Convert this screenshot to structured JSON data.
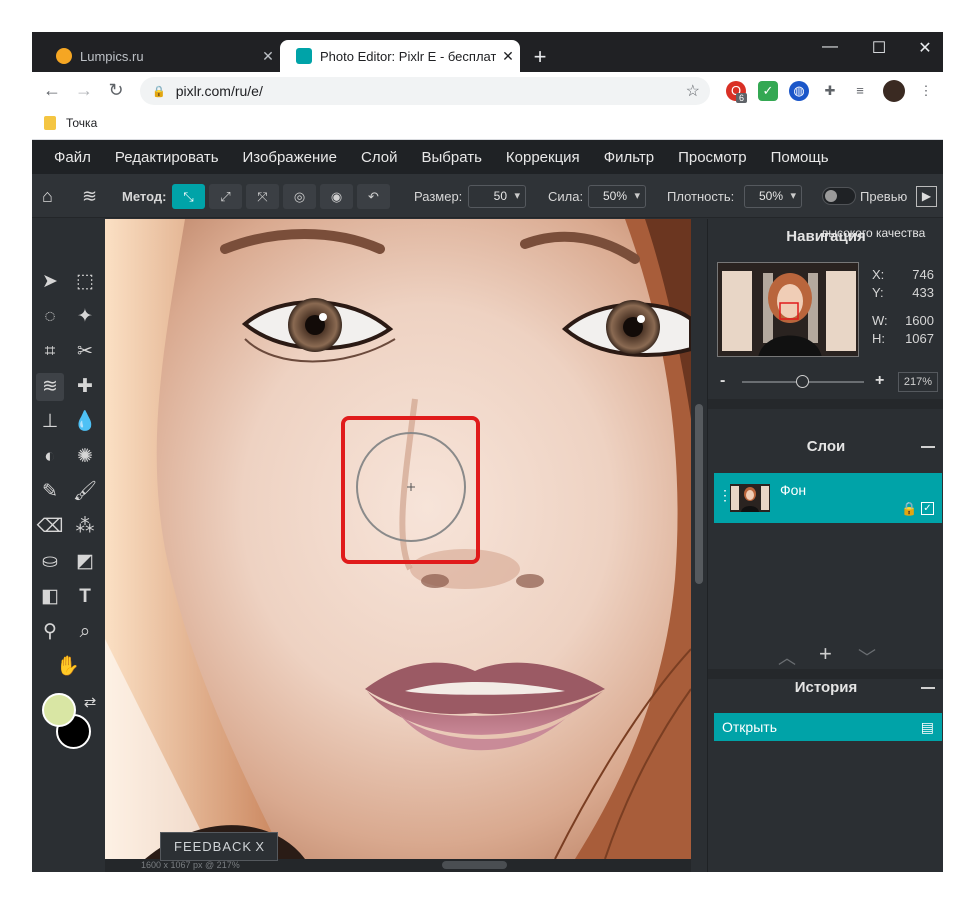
{
  "browser": {
    "tabs": [
      {
        "title": "Lumpics.ru",
        "favicon_color": "#f5a623"
      },
      {
        "title": "Photo Editor: Pixlr E - бесплатный",
        "favicon_color": "#00a3a8"
      }
    ],
    "new_tab": "+",
    "window_controls": {
      "minimize": "—",
      "maximize": "☐",
      "close": "✕"
    },
    "nav": {
      "back": "←",
      "forward": "→",
      "reload": "↻"
    },
    "url": "pixlr.com/ru/e/",
    "extension_badge": "6",
    "bookmark": "Точка"
  },
  "menu": [
    "Файл",
    "Редактировать",
    "Изображение",
    "Слой",
    "Выбрать",
    "Коррекция",
    "Фильтр",
    "Просмотр",
    "Помощь"
  ],
  "options": {
    "method_label": "Метод:",
    "size_label": "Размер:",
    "size_value": "50",
    "strength_label": "Сила:",
    "strength_value": "50%",
    "density_label": "Плотность:",
    "density_value": "50%",
    "preview_label": "Превью",
    "preview_enabled": false,
    "tooltip": "высокого качества"
  },
  "navigation": {
    "title": "Навигация",
    "x_label": "X:",
    "x": "746",
    "y_label": "Y:",
    "y": "433",
    "w_label": "W:",
    "w": "1600",
    "h_label": "H:",
    "h": "1067",
    "zoom_minus": "-",
    "zoom_plus": "+",
    "zoom": "217%"
  },
  "layers": {
    "title": "Слои",
    "items": [
      {
        "name": "Фон"
      }
    ]
  },
  "history": {
    "title": "История",
    "items": [
      {
        "label": "Открыть"
      }
    ]
  },
  "status": "1600 x 1067 px @ 217%",
  "feedback": {
    "label": "FEEDBACK",
    "close": "X"
  },
  "colors": {
    "accent": "#00a3a8",
    "primary_swatch": "#d9e6a4",
    "secondary_swatch": "#000000",
    "highlight_box": "#e01b1b"
  },
  "icons": {
    "home": "home-icon",
    "brush_tool": "liquify-icon"
  }
}
